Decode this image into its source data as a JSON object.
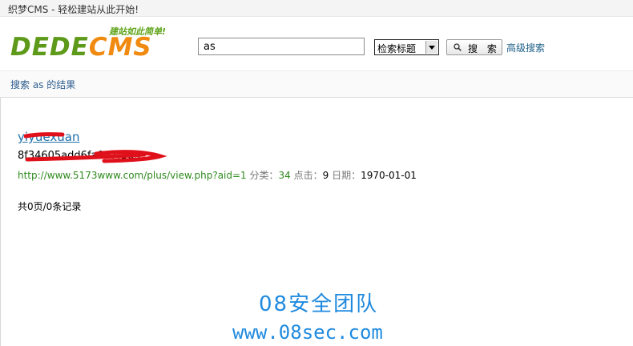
{
  "window": {
    "title": "织梦CMS - 轻松建站从此开始!"
  },
  "header": {
    "logo": {
      "slogan": "建站如此简单!",
      "brand_part1": "DEDE",
      "brand_part2": "CMS"
    },
    "search": {
      "value": "as",
      "select_value": "检索标题",
      "button_label": "搜 索",
      "advanced_link": "高级搜索"
    }
  },
  "subbar": {
    "crumb": "搜索 as 的结果"
  },
  "results": [
    {
      "title": "yiyuexuan",
      "description": "8f34605add6fa0d7f385",
      "url": "http://www.5173www.com/plus/view.php?aid=1",
      "category_label": "分类：",
      "category_value": "34",
      "clicks_label": "点击：",
      "clicks_value": "9",
      "date_label": "日期：",
      "date_value": "1970-01-01"
    }
  ],
  "pager": {
    "text": "共0页/0条记录"
  },
  "watermark": {
    "line1": "08安全团队",
    "line2": "www.08sec.com"
  },
  "colors": {
    "link": "#1e6ea8",
    "url_green": "#2f8a1f",
    "logo_green": "#5e9a1a",
    "logo_orange": "#f08a10",
    "watermark": "#1f8adf",
    "redaction": "#e0101a"
  }
}
